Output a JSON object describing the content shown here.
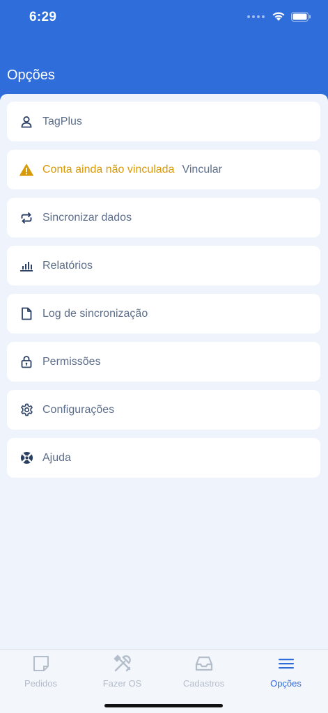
{
  "status_bar": {
    "time": "6:29"
  },
  "header": {
    "title": "Opções"
  },
  "menu": {
    "items": [
      {
        "label": "TagPlus",
        "icon": "user-icon"
      },
      {
        "label": "Conta ainda não vinculada",
        "action": "Vincular",
        "icon": "warning-icon"
      },
      {
        "label": "Sincronizar dados",
        "icon": "sync-icon"
      },
      {
        "label": "Relatórios",
        "icon": "bar-chart-icon"
      },
      {
        "label": "Log de sincronização",
        "icon": "file-icon"
      },
      {
        "label": "Permissões",
        "icon": "lock-icon"
      },
      {
        "label": "Configurações",
        "icon": "gear-icon"
      },
      {
        "label": "Ajuda",
        "icon": "lifebuoy-icon"
      }
    ]
  },
  "tabbar": {
    "tabs": [
      {
        "label": "Pedidos",
        "icon": "note-icon",
        "active": false
      },
      {
        "label": "Fazer OS",
        "icon": "tools-icon",
        "active": false
      },
      {
        "label": "Cadastros",
        "icon": "inbox-icon",
        "active": false
      },
      {
        "label": "Opções",
        "icon": "menu-icon",
        "active": true
      }
    ]
  },
  "colors": {
    "header": "#2f6ddb",
    "background": "#eef3fc",
    "item_text": "#5d6f8c",
    "icon": "#2b3f63",
    "warning": "#d99a09",
    "tab_active": "#2f6ddb",
    "tab_inactive": "#b4bdca"
  }
}
